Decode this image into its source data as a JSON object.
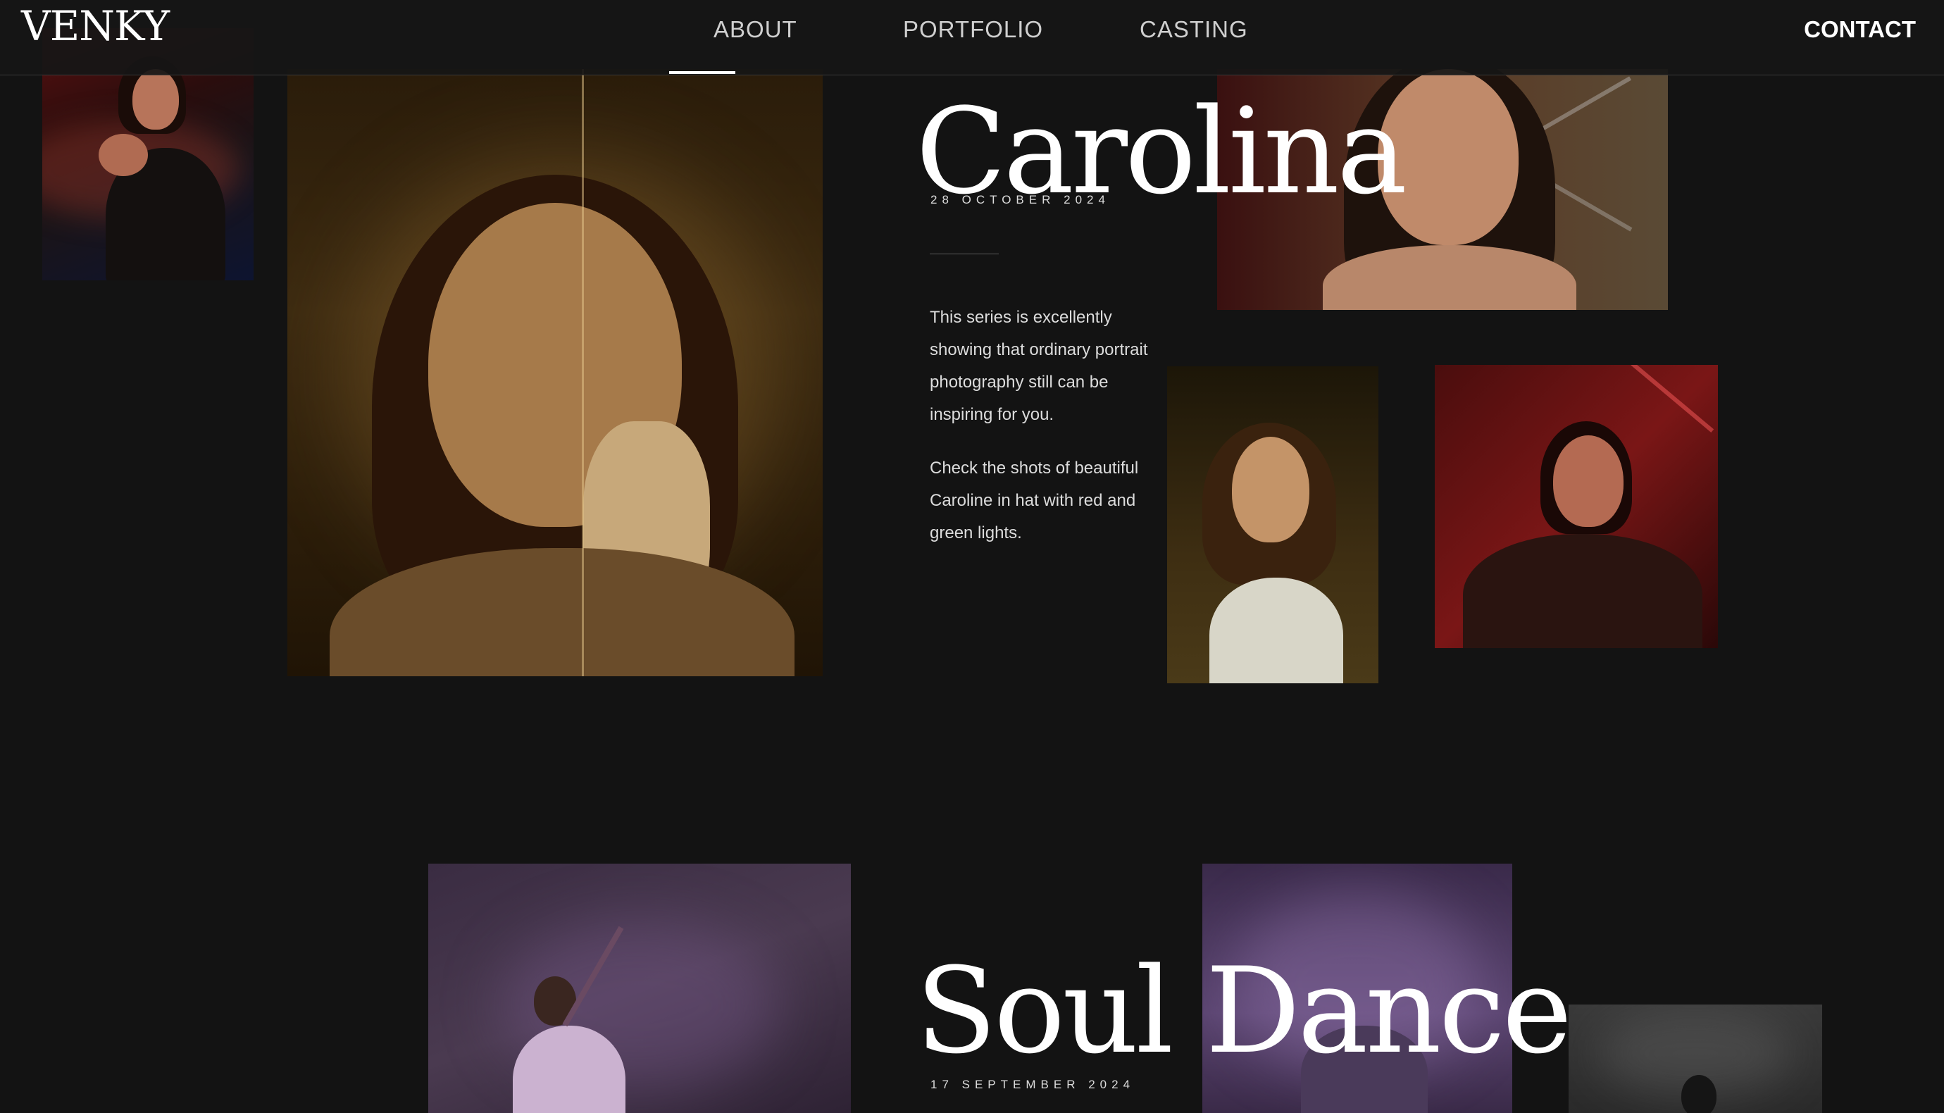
{
  "header": {
    "logo": "VENKY",
    "nav": [
      {
        "label": "ABOUT"
      },
      {
        "label": "PORTFOLIO"
      },
      {
        "label": "CASTING"
      }
    ],
    "contact_label": "CONTACT"
  },
  "stories": [
    {
      "title": "Carolina",
      "date": "28 OCTOBER 2024",
      "paragraphs": [
        "This series is excellently showing that ordinary portrait photography still can be inspiring for you.",
        "Check the shots of beautiful Caroline in hat with red and green lights."
      ]
    },
    {
      "title": "Soul Dance",
      "date": "17 SEPTEMBER 2024"
    }
  ],
  "colors": {
    "background": "#131313",
    "header": "#161616",
    "text": "#ffffff",
    "muted_text": "#dcdcdc",
    "warm_photo": "#4a3314",
    "red_photo": "#6a1414",
    "purple_photo": "#3d2a4a"
  }
}
